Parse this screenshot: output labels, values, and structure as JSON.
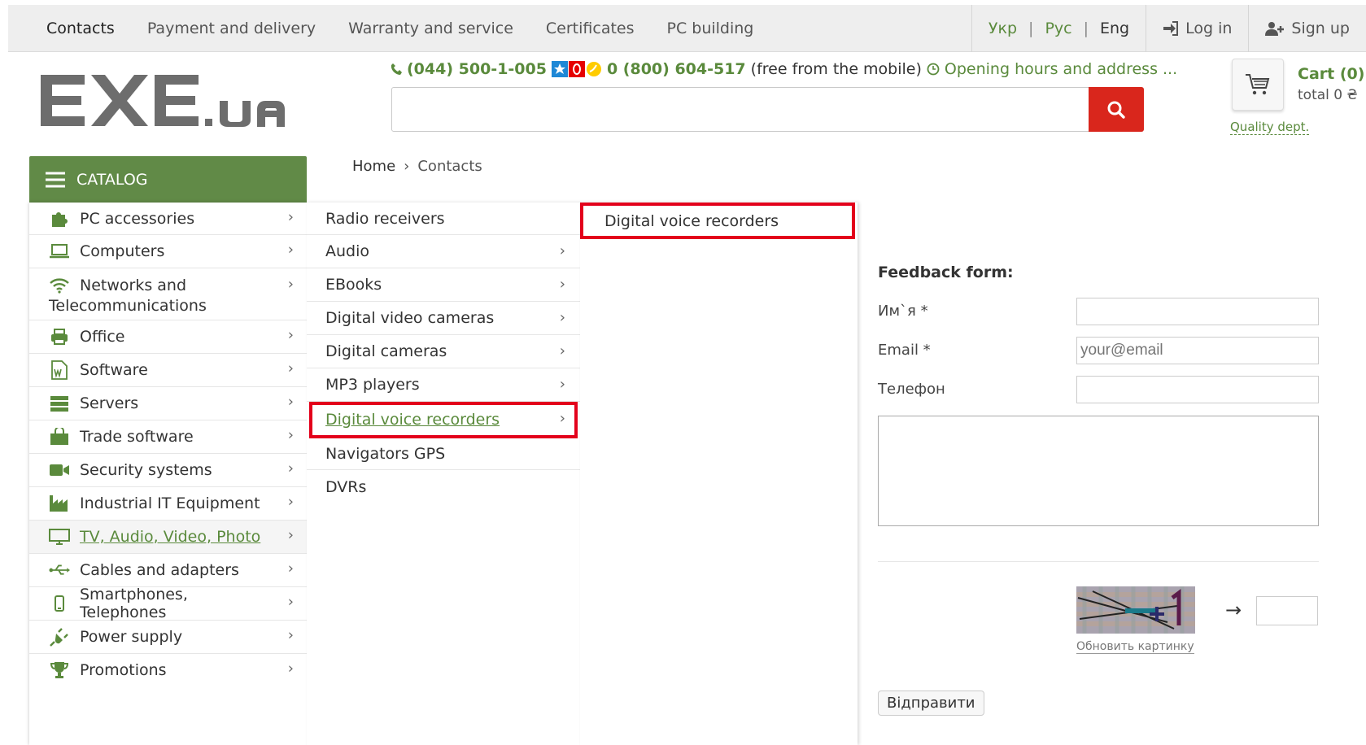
{
  "topnav": {
    "links": [
      "Contacts",
      "Payment and delivery",
      "Warranty and service",
      "Certificates",
      "PC building"
    ],
    "languages": [
      "Укр",
      "Рус",
      "Eng"
    ],
    "login": "Log in",
    "signup": "Sign up"
  },
  "header": {
    "phone1": "(044) 500-1-005",
    "phone2": "0 (800) 604-517",
    "phone2_note": "(free from the mobile)",
    "hours_link": "Opening hours and address ...",
    "search_placeholder": "",
    "cart_title": "Cart (0)",
    "cart_total": "total 0 ₴",
    "quality_link": "Quality dept."
  },
  "breadcrumb": {
    "home": "Home",
    "sep": "›",
    "current": "Contacts"
  },
  "catalog": {
    "title": "CATALOG",
    "items": [
      {
        "label": "PC accessories",
        "icon": "puzzle-icon"
      },
      {
        "label": "Computers",
        "icon": "laptop-icon"
      },
      {
        "label": "Networks and Telecommunications",
        "icon": "wifi-icon"
      },
      {
        "label": "Office",
        "icon": "printer-icon"
      },
      {
        "label": "Software",
        "icon": "word-file-icon"
      },
      {
        "label": "Servers",
        "icon": "server-icon"
      },
      {
        "label": "Trade software",
        "icon": "shopping-bag-icon"
      },
      {
        "label": "Security systems",
        "icon": "video-camera-icon"
      },
      {
        "label": "Industrial IT Equipment",
        "icon": "factory-icon"
      },
      {
        "label": "TV, Audio, Video, Photo",
        "icon": "monitor-icon"
      },
      {
        "label": "Cables and adapters",
        "icon": "usb-icon"
      },
      {
        "label": "Smartphones, Telephones",
        "icon": "smartphone-icon"
      },
      {
        "label": "Power supply",
        "icon": "plug-icon"
      },
      {
        "label": "Promotions",
        "icon": "trophy-icon"
      }
    ],
    "active": "TV, Audio, Video, Photo"
  },
  "submenu": {
    "items": [
      "Radio receivers",
      "Audio",
      "EBooks",
      "Digital video cameras",
      "Digital cameras",
      "MP3 players",
      "Digital voice recorders",
      "Navigators GPS",
      "DVRs"
    ],
    "has_children": [
      false,
      true,
      true,
      true,
      true,
      true,
      true,
      false,
      false
    ],
    "active": "Digital voice recorders"
  },
  "subsubmenu": {
    "items": [
      "Digital voice recorders"
    ]
  },
  "form": {
    "title": "Feedback form:",
    "name_label": "Им`я *",
    "email_label": "Email *",
    "email_placeholder": "your@email",
    "phone_label": "Телефон",
    "captcha_refresh": "Обновить картинку",
    "submit": "Відправити"
  },
  "colors": {
    "accent": "#5a8a3c",
    "catalog": "#618a47",
    "search": "#d9261c",
    "highlight": "#e3001b"
  }
}
